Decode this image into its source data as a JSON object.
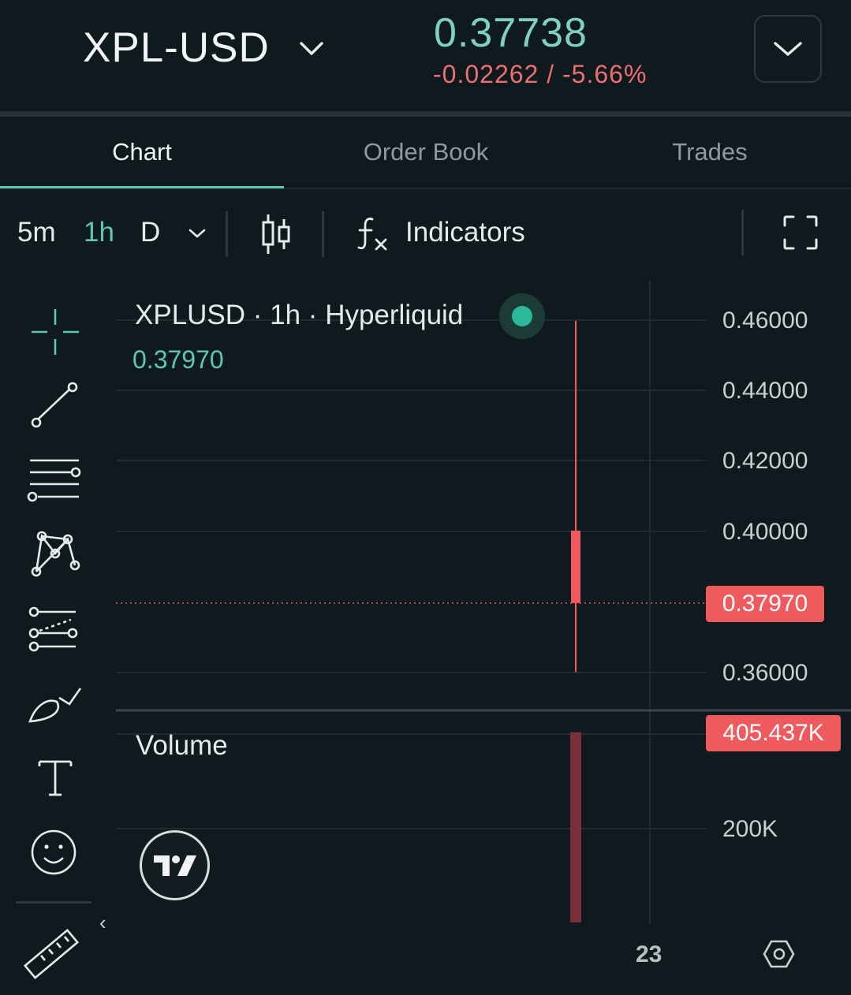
{
  "header": {
    "pair": "XPL-USD",
    "price": "0.37738",
    "change": "-0.02262 / -5.66%"
  },
  "tabs": [
    {
      "label": "Chart",
      "active": true
    },
    {
      "label": "Order Book",
      "active": false
    },
    {
      "label": "Trades",
      "active": false
    }
  ],
  "toolbar": {
    "timeframes": [
      "5m",
      "1h",
      "D"
    ],
    "active_timeframe": "1h",
    "indicators_label": "Indicators"
  },
  "legend": {
    "title": "XPLUSD · 1h · Hyperliquid",
    "last_value": "0.37970"
  },
  "sidebar_tools": [
    "crosshair-icon",
    "trend-line-icon",
    "parallel-lines-icon",
    "pattern-icon",
    "fib-retracement-icon",
    "brush-icon",
    "text-icon",
    "emoji-icon",
    "ruler-icon"
  ],
  "colors": {
    "accent": "#5fc7b0",
    "down": "#ee5a5d",
    "background": "#0f1a1f"
  },
  "chart_data": {
    "type": "candlestick",
    "price_axis": {
      "ticks": [
        "0.46000",
        "0.44000",
        "0.42000",
        "0.40000",
        "0.36000"
      ],
      "range": [
        0.348,
        0.471
      ]
    },
    "x_axis": {
      "ticks": [
        "23"
      ]
    },
    "last_price_label": "0.37970",
    "candles": [
      {
        "open": 0.40026,
        "high": 0.4598,
        "low": 0.3601,
        "close": 0.3797
      }
    ],
    "volume": {
      "label": "Volume",
      "ticks": [
        "200K"
      ],
      "last_label": "405.437K",
      "values": [
        405437
      ]
    }
  }
}
